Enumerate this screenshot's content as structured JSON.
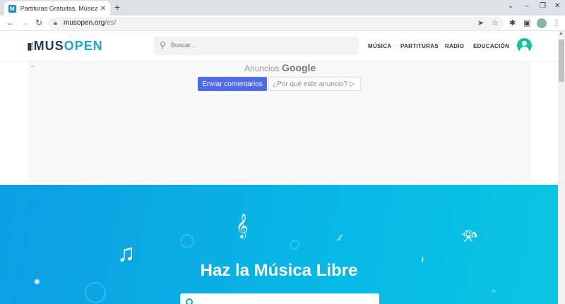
{
  "browser": {
    "tab_title": "Partituras Gratuitas, Música Libre",
    "tab_favicon_letter": "M",
    "url_host": "musopen.org",
    "url_path": "/es/"
  },
  "site": {
    "logo_mus": "MUS",
    "logo_open": "OPEN",
    "search_placeholder": "Buscar...",
    "nav": [
      "MÚSICA",
      "PARTITURAS",
      "RADIO",
      "EDUCACIÓN"
    ],
    "colors": {
      "brand_blue": "#1ca3d6",
      "avatar": "#17c19c",
      "hero_start": "#0d9ee3",
      "hero_end": "#0ac6e2"
    }
  },
  "ad": {
    "label": "Anuncios",
    "brand": "Google",
    "feedback_button": "Enviar comentarios",
    "why_button": "¿Por qué este anuncio? ▷"
  },
  "hero": {
    "title": "Haz la Música Libre"
  }
}
